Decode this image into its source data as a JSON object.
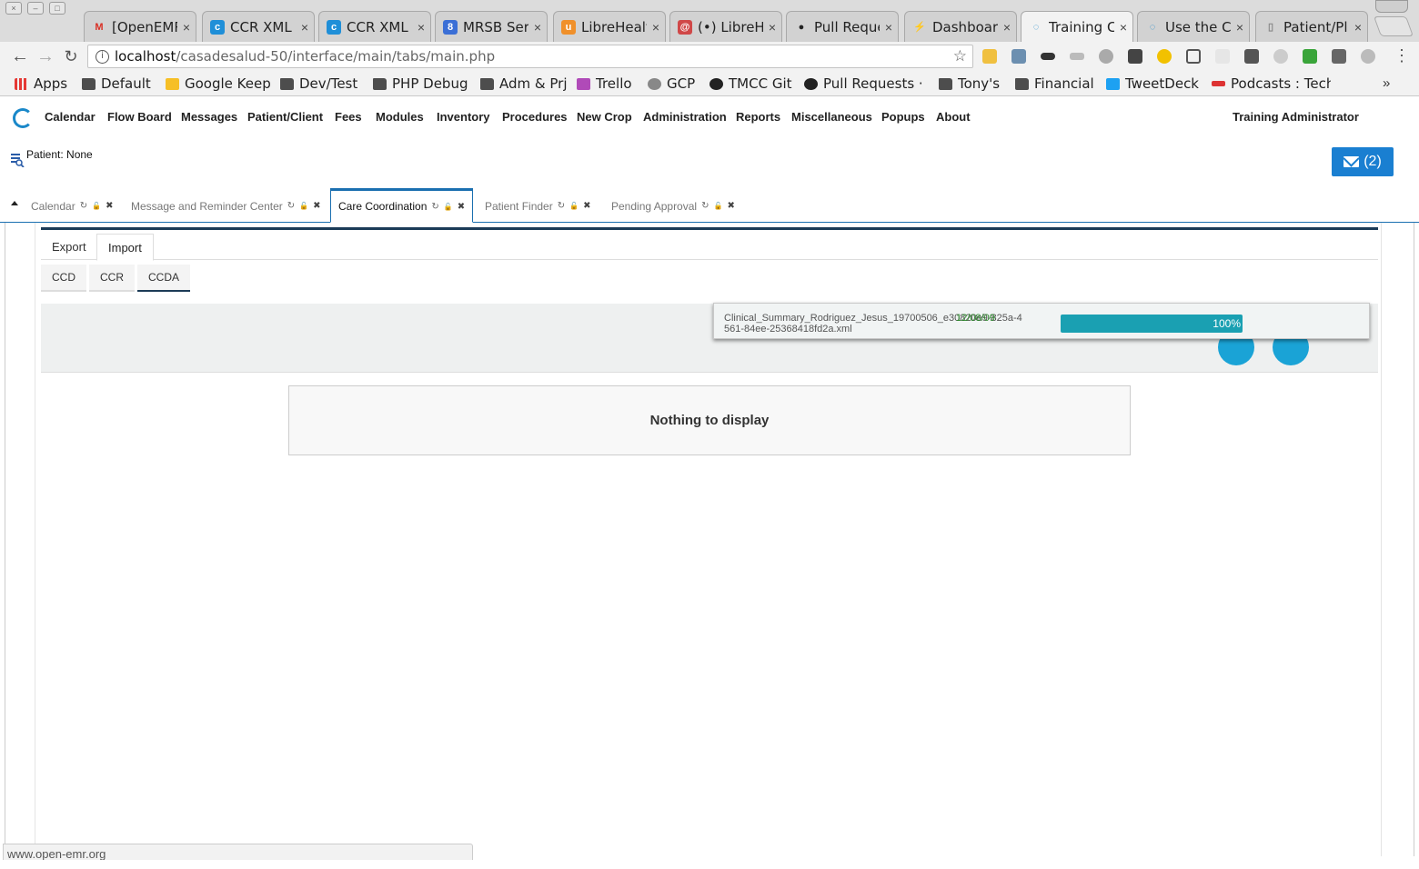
{
  "browser": {
    "tabs": [
      {
        "title": "[OpenEMR",
        "favicon": "gmail"
      },
      {
        "title": "CCR XML f",
        "favicon": "confluence"
      },
      {
        "title": "CCR XML f",
        "favicon": "confluence"
      },
      {
        "title": "MRSB Serv",
        "favicon": "calendar"
      },
      {
        "title": "LibreHealt",
        "favicon": "gitlab"
      },
      {
        "title": "(•) LibreHe",
        "favicon": "chat"
      },
      {
        "title": "Pull Reque",
        "favicon": "github"
      },
      {
        "title": "Dashboard",
        "favicon": "dashboard"
      },
      {
        "title": "Training C",
        "favicon": "openemr"
      },
      {
        "title": "Use the Ca",
        "favicon": "openemr"
      },
      {
        "title": "Patient/Pl",
        "favicon": "page"
      }
    ],
    "active_tab_index": 8,
    "url_host": "localhost",
    "url_path": "/casadesalud-50/interface/main/tabs/main.php",
    "bookmarks": [
      {
        "label": "Apps",
        "icon": "apps-grid-icon"
      },
      {
        "label": "Default",
        "icon": "folder-icon"
      },
      {
        "label": "Google Keep",
        "icon": "keep-icon"
      },
      {
        "label": "Dev/Test",
        "icon": "folder-icon"
      },
      {
        "label": "PHP Debug",
        "icon": "folder-icon"
      },
      {
        "label": "Adm & Prj",
        "icon": "folder-icon"
      },
      {
        "label": "Trello",
        "icon": "trello-icon"
      },
      {
        "label": "GCP",
        "icon": "gcp-icon"
      },
      {
        "label": "TMCC Git",
        "icon": "github-icon"
      },
      {
        "label": "Pull Requests · L",
        "icon": "github-icon"
      },
      {
        "label": "Tony's",
        "icon": "folder-icon"
      },
      {
        "label": "Financial",
        "icon": "folder-icon"
      },
      {
        "label": "TweetDeck",
        "icon": "tweetdeck-icon"
      },
      {
        "label": "Podcasts : Techr",
        "icon": "podcast-icon"
      }
    ],
    "more": "»",
    "status_url": "www.open-emr.org"
  },
  "emr": {
    "menu": [
      "Calendar",
      "Flow Board",
      "Messages",
      "Patient/Client",
      "Fees",
      "Modules",
      "Inventory",
      "Procedures",
      "New Crop",
      "Administration",
      "Reports",
      "Miscellaneous",
      "Popups",
      "About"
    ],
    "user": "Training Administrator",
    "patient_label": "Patient: None",
    "messages_count": "(2)",
    "tabs": [
      {
        "label": "Calendar",
        "active": false
      },
      {
        "label": "Message and Reminder Center",
        "active": false
      },
      {
        "label": "Care Coordination",
        "active": true
      },
      {
        "label": "Patient Finder",
        "active": false
      },
      {
        "label": "Pending Approval",
        "active": false
      }
    ]
  },
  "care": {
    "subtabs": [
      "Export",
      "Import"
    ],
    "active_subtab": "Import",
    "formats": [
      "CCD",
      "CCR",
      "CCDA"
    ],
    "active_format": "CCDA",
    "upload": {
      "filename": "Clinical_Summary_Rodriguez_Jesus_19700506_e30820e9-825a-4561-84ee-25368418fd2a.xml",
      "date_overlay": "12/08/09",
      "progress_percent": 100,
      "progress_label": "100%"
    },
    "empty_text": "Nothing to display"
  },
  "colors": {
    "accent": "#1a6fb0",
    "progress": "#1aa0b2",
    "mail_button": "#1a7fd1",
    "header_line": "#1c3b57"
  }
}
